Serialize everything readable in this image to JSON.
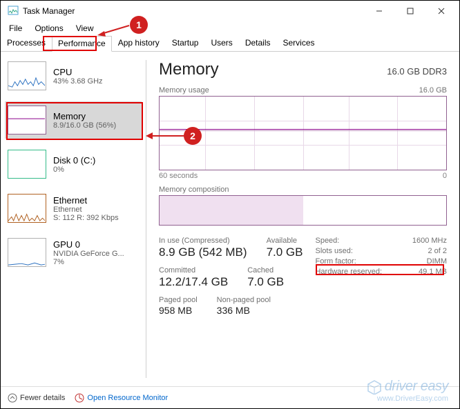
{
  "window": {
    "title": "Task Manager"
  },
  "menus": {
    "file": "File",
    "options": "Options",
    "view": "View"
  },
  "tabs": {
    "processes": "Processes",
    "performance": "Performance",
    "app_history": "App history",
    "startup": "Startup",
    "users": "Users",
    "details": "Details",
    "services": "Services"
  },
  "sidebar": {
    "cpu": {
      "name": "CPU",
      "sub": "43% 3.68 GHz"
    },
    "memory": {
      "name": "Memory",
      "sub": "8.9/16.0 GB (56%)"
    },
    "disk0": {
      "name": "Disk 0 (C:)",
      "sub": "0%"
    },
    "ethernet": {
      "name": "Ethernet",
      "sub1": "Ethernet",
      "sub2": "S: 112 R: 392 Kbps"
    },
    "gpu0": {
      "name": "GPU 0",
      "sub1": "NVIDIA GeForce G...",
      "sub2": "7%"
    }
  },
  "main": {
    "title": "Memory",
    "total": "16.0 GB DDR3",
    "usage_label": "Memory usage",
    "usage_max": "16.0 GB",
    "axis_left": "60 seconds",
    "axis_right": "0",
    "composition_label": "Memory composition",
    "stats": {
      "in_use_k": "In use (Compressed)",
      "in_use_v": "8.9 GB (542 MB)",
      "available_k": "Available",
      "available_v": "7.0 GB",
      "committed_k": "Committed",
      "committed_v": "12.2/17.4 GB",
      "cached_k": "Cached",
      "cached_v": "7.0 GB",
      "paged_k": "Paged pool",
      "paged_v": "958 MB",
      "nonpaged_k": "Non-paged pool",
      "nonpaged_v": "336 MB"
    },
    "kv": {
      "speed_k": "Speed:",
      "speed_v": "1600 MHz",
      "slots_k": "Slots used:",
      "slots_v": "2 of 2",
      "form_k": "Form factor:",
      "form_v": "DIMM",
      "hw_k": "Hardware reserved:",
      "hw_v": "49.1 MB"
    }
  },
  "footer": {
    "fewer": "Fewer details",
    "resmon": "Open Resource Monitor"
  },
  "watermark": {
    "brand": "driver easy",
    "url": "www.DriverEasy.com"
  },
  "chart_data": {
    "type": "line",
    "title": "Memory usage",
    "xlabel": "60 seconds",
    "ylabel": "",
    "ylim": [
      0,
      16.0
    ],
    "x": [
      60,
      55,
      50,
      45,
      40,
      35,
      30,
      25,
      20,
      15,
      10,
      5,
      0
    ],
    "series": [
      {
        "name": "Memory GB",
        "values": [
          9.0,
          9.0,
          9.0,
          8.9,
          8.9,
          8.9,
          8.9,
          8.9,
          8.9,
          8.9,
          8.9,
          8.9,
          8.9
        ]
      }
    ]
  }
}
